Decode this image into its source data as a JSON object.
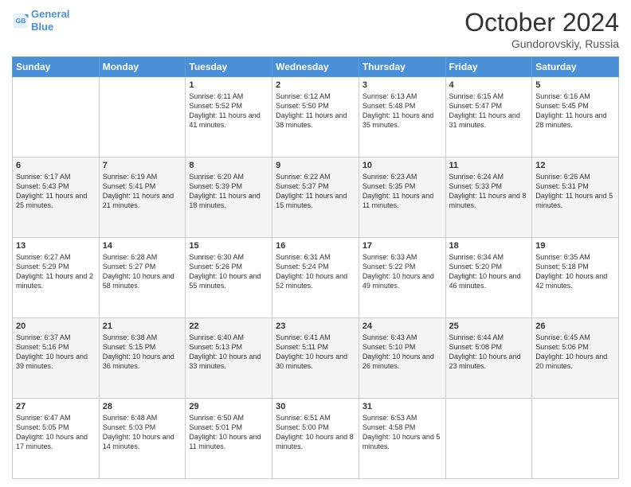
{
  "header": {
    "logo_line1": "General",
    "logo_line2": "Blue",
    "month": "October 2024",
    "location": "Gundorovskiy, Russia"
  },
  "days_of_week": [
    "Sunday",
    "Monday",
    "Tuesday",
    "Wednesday",
    "Thursday",
    "Friday",
    "Saturday"
  ],
  "weeks": [
    [
      {
        "day": "",
        "info": ""
      },
      {
        "day": "",
        "info": ""
      },
      {
        "day": "1",
        "info": "Sunrise: 6:11 AM\nSunset: 5:52 PM\nDaylight: 11 hours and 41 minutes."
      },
      {
        "day": "2",
        "info": "Sunrise: 6:12 AM\nSunset: 5:50 PM\nDaylight: 11 hours and 38 minutes."
      },
      {
        "day": "3",
        "info": "Sunrise: 6:13 AM\nSunset: 5:48 PM\nDaylight: 11 hours and 35 minutes."
      },
      {
        "day": "4",
        "info": "Sunrise: 6:15 AM\nSunset: 5:47 PM\nDaylight: 11 hours and 31 minutes."
      },
      {
        "day": "5",
        "info": "Sunrise: 6:16 AM\nSunset: 5:45 PM\nDaylight: 11 hours and 28 minutes."
      }
    ],
    [
      {
        "day": "6",
        "info": "Sunrise: 6:17 AM\nSunset: 5:43 PM\nDaylight: 11 hours and 25 minutes."
      },
      {
        "day": "7",
        "info": "Sunrise: 6:19 AM\nSunset: 5:41 PM\nDaylight: 11 hours and 21 minutes."
      },
      {
        "day": "8",
        "info": "Sunrise: 6:20 AM\nSunset: 5:39 PM\nDaylight: 11 hours and 18 minutes."
      },
      {
        "day": "9",
        "info": "Sunrise: 6:22 AM\nSunset: 5:37 PM\nDaylight: 11 hours and 15 minutes."
      },
      {
        "day": "10",
        "info": "Sunrise: 6:23 AM\nSunset: 5:35 PM\nDaylight: 11 hours and 11 minutes."
      },
      {
        "day": "11",
        "info": "Sunrise: 6:24 AM\nSunset: 5:33 PM\nDaylight: 11 hours and 8 minutes."
      },
      {
        "day": "12",
        "info": "Sunrise: 6:26 AM\nSunset: 5:31 PM\nDaylight: 11 hours and 5 minutes."
      }
    ],
    [
      {
        "day": "13",
        "info": "Sunrise: 6:27 AM\nSunset: 5:29 PM\nDaylight: 11 hours and 2 minutes."
      },
      {
        "day": "14",
        "info": "Sunrise: 6:28 AM\nSunset: 5:27 PM\nDaylight: 10 hours and 58 minutes."
      },
      {
        "day": "15",
        "info": "Sunrise: 6:30 AM\nSunset: 5:26 PM\nDaylight: 10 hours and 55 minutes."
      },
      {
        "day": "16",
        "info": "Sunrise: 6:31 AM\nSunset: 5:24 PM\nDaylight: 10 hours and 52 minutes."
      },
      {
        "day": "17",
        "info": "Sunrise: 6:33 AM\nSunset: 5:22 PM\nDaylight: 10 hours and 49 minutes."
      },
      {
        "day": "18",
        "info": "Sunrise: 6:34 AM\nSunset: 5:20 PM\nDaylight: 10 hours and 46 minutes."
      },
      {
        "day": "19",
        "info": "Sunrise: 6:35 AM\nSunset: 5:18 PM\nDaylight: 10 hours and 42 minutes."
      }
    ],
    [
      {
        "day": "20",
        "info": "Sunrise: 6:37 AM\nSunset: 5:16 PM\nDaylight: 10 hours and 39 minutes."
      },
      {
        "day": "21",
        "info": "Sunrise: 6:38 AM\nSunset: 5:15 PM\nDaylight: 10 hours and 36 minutes."
      },
      {
        "day": "22",
        "info": "Sunrise: 6:40 AM\nSunset: 5:13 PM\nDaylight: 10 hours and 33 minutes."
      },
      {
        "day": "23",
        "info": "Sunrise: 6:41 AM\nSunset: 5:11 PM\nDaylight: 10 hours and 30 minutes."
      },
      {
        "day": "24",
        "info": "Sunrise: 6:43 AM\nSunset: 5:10 PM\nDaylight: 10 hours and 26 minutes."
      },
      {
        "day": "25",
        "info": "Sunrise: 6:44 AM\nSunset: 5:08 PM\nDaylight: 10 hours and 23 minutes."
      },
      {
        "day": "26",
        "info": "Sunrise: 6:45 AM\nSunset: 5:06 PM\nDaylight: 10 hours and 20 minutes."
      }
    ],
    [
      {
        "day": "27",
        "info": "Sunrise: 6:47 AM\nSunset: 5:05 PM\nDaylight: 10 hours and 17 minutes."
      },
      {
        "day": "28",
        "info": "Sunrise: 6:48 AM\nSunset: 5:03 PM\nDaylight: 10 hours and 14 minutes."
      },
      {
        "day": "29",
        "info": "Sunrise: 6:50 AM\nSunset: 5:01 PM\nDaylight: 10 hours and 11 minutes."
      },
      {
        "day": "30",
        "info": "Sunrise: 6:51 AM\nSunset: 5:00 PM\nDaylight: 10 hours and 8 minutes."
      },
      {
        "day": "31",
        "info": "Sunrise: 6:53 AM\nSunset: 4:58 PM\nDaylight: 10 hours and 5 minutes."
      },
      {
        "day": "",
        "info": ""
      },
      {
        "day": "",
        "info": ""
      }
    ]
  ]
}
